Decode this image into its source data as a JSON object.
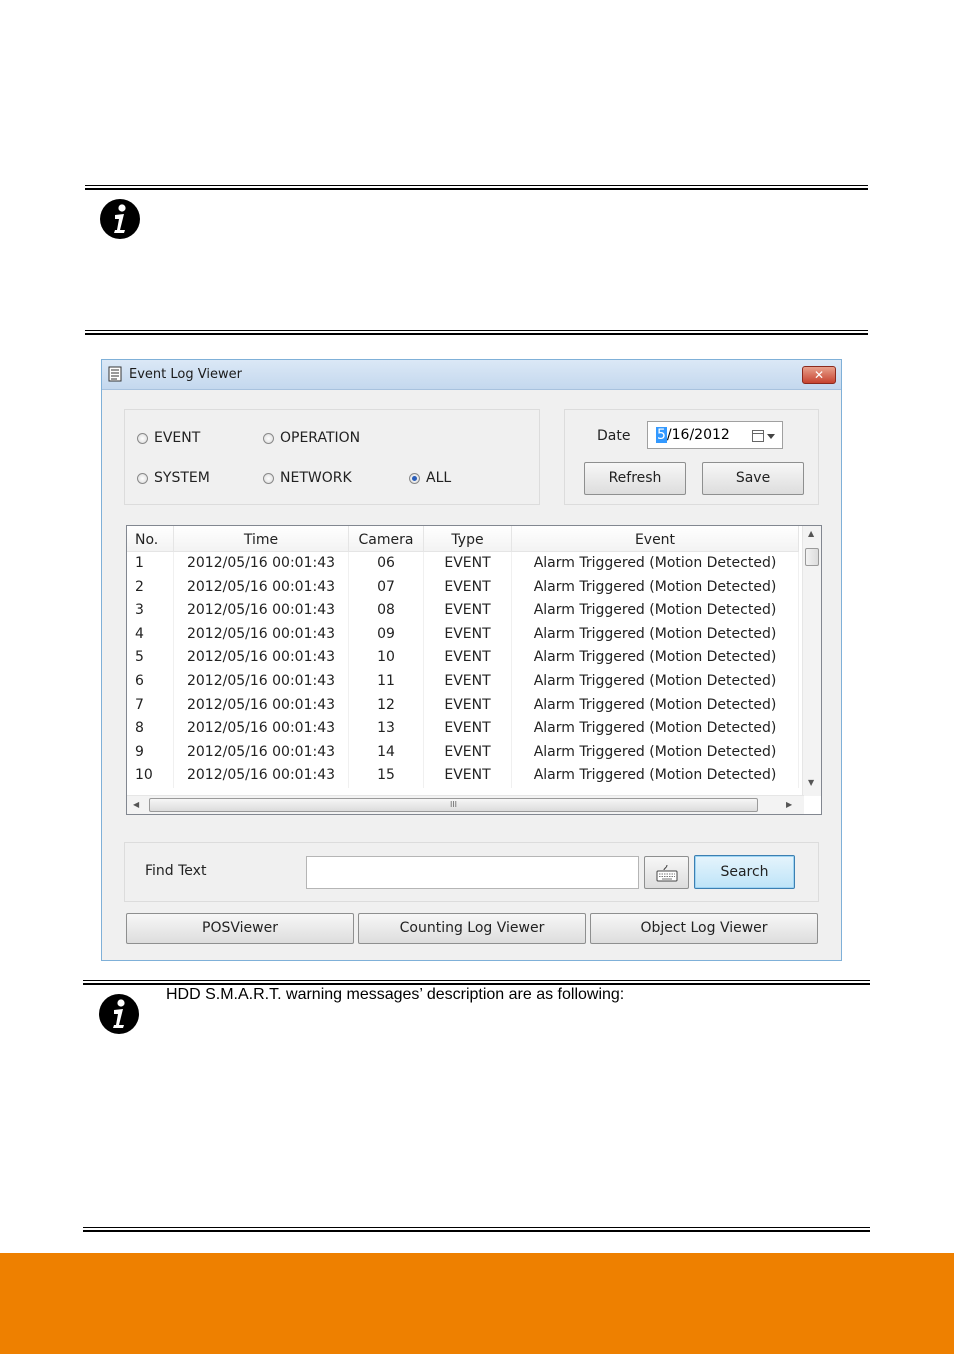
{
  "window": {
    "title": "Event Log Viewer",
    "close_glyph": "✕"
  },
  "filters": {
    "options": [
      {
        "label": "EVENT",
        "selected": false
      },
      {
        "label": "OPERATION",
        "selected": false
      },
      {
        "label": "SYSTEM",
        "selected": false
      },
      {
        "label": "NETWORK",
        "selected": false
      },
      {
        "label": "ALL",
        "selected": true
      }
    ]
  },
  "date": {
    "label": "Date",
    "value_selected": "5",
    "value_rest": "/16/2012",
    "calendar_icon": "calendar-icon"
  },
  "actions": {
    "refresh": "Refresh",
    "save": "Save"
  },
  "table": {
    "columns": [
      "No.",
      "Time",
      "Camera",
      "Type",
      "Event"
    ],
    "rows": [
      [
        "1",
        "2012/05/16 00:01:43",
        "06",
        "EVENT",
        "Alarm Triggered (Motion Detected)"
      ],
      [
        "2",
        "2012/05/16 00:01:43",
        "07",
        "EVENT",
        "Alarm Triggered (Motion Detected)"
      ],
      [
        "3",
        "2012/05/16 00:01:43",
        "08",
        "EVENT",
        "Alarm Triggered (Motion Detected)"
      ],
      [
        "4",
        "2012/05/16 00:01:43",
        "09",
        "EVENT",
        "Alarm Triggered (Motion Detected)"
      ],
      [
        "5",
        "2012/05/16 00:01:43",
        "10",
        "EVENT",
        "Alarm Triggered (Motion Detected)"
      ],
      [
        "6",
        "2012/05/16 00:01:43",
        "11",
        "EVENT",
        "Alarm Triggered (Motion Detected)"
      ],
      [
        "7",
        "2012/05/16 00:01:43",
        "12",
        "EVENT",
        "Alarm Triggered (Motion Detected)"
      ],
      [
        "8",
        "2012/05/16 00:01:43",
        "13",
        "EVENT",
        "Alarm Triggered (Motion Detected)"
      ],
      [
        "9",
        "2012/05/16 00:01:43",
        "14",
        "EVENT",
        "Alarm Triggered (Motion Detected)"
      ],
      [
        "10",
        "2012/05/16 00:01:43",
        "15",
        "EVENT",
        "Alarm Triggered (Motion Detected)"
      ]
    ],
    "hscroll_grip": "III"
  },
  "find": {
    "label": "Find Text",
    "value": "",
    "keyboard_icon": "keyboard-icon",
    "search": "Search"
  },
  "bottom_buttons": {
    "pos": "POSViewer",
    "counting": "Counting Log Viewer",
    "object": "Object Log Viewer"
  },
  "note": {
    "text": "HDD S.M.A.R.T. warning messages’ description are as following:"
  },
  "colors": {
    "footer": "#ee8000",
    "accent": "#3399ff"
  }
}
